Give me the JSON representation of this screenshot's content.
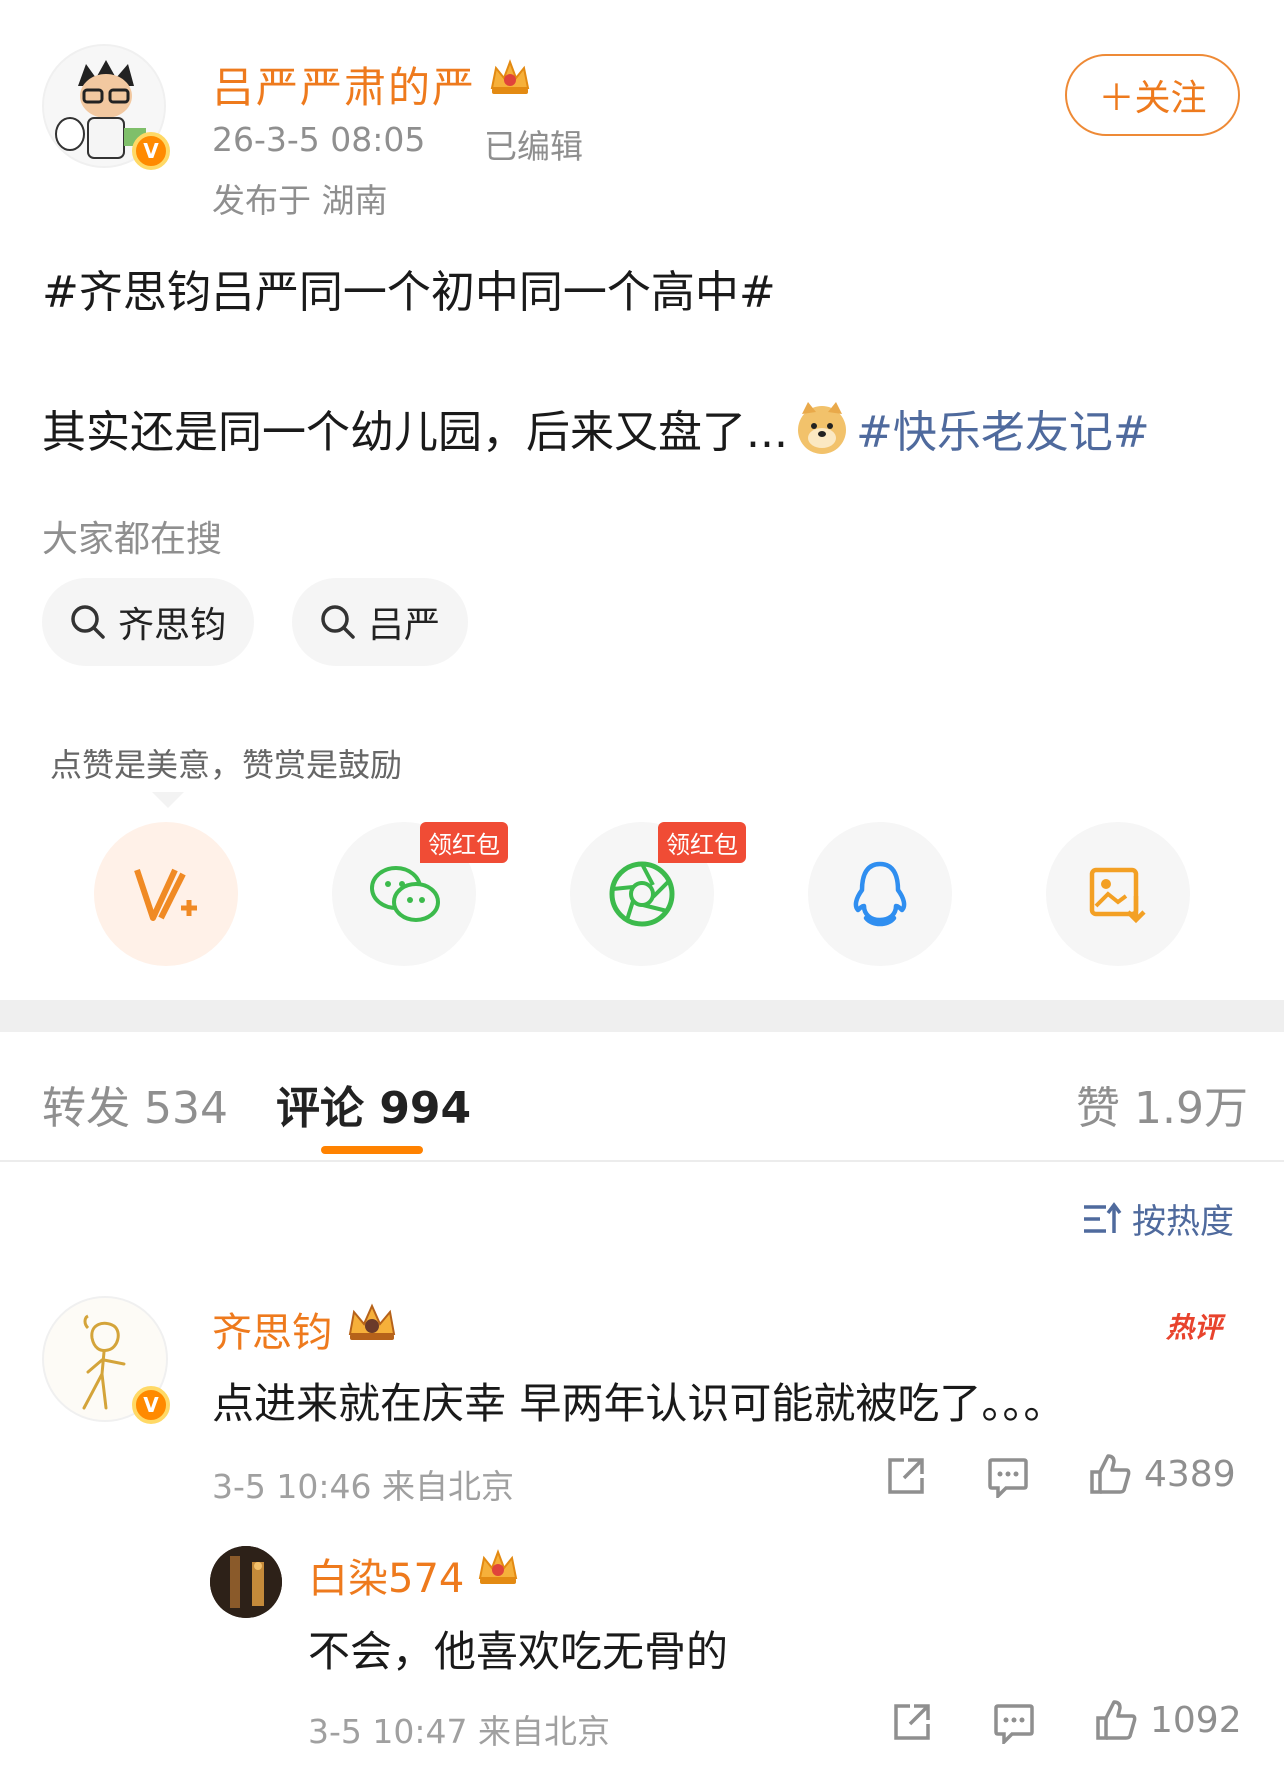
{
  "post": {
    "author": "吕严严肃的严",
    "time": "26-3-5 08:05",
    "edited": "已编辑",
    "location": "发布于 湖南",
    "follow": "＋关注",
    "topic": "#齐思钧吕严同一个初中同一个高中#",
    "text": "其实还是同一个幼儿园，后来又盘了...",
    "topic2": "#快乐老友记#"
  },
  "search": {
    "label": "大家都在搜",
    "chips": [
      "齐思钧",
      "吕严"
    ]
  },
  "share": {
    "tip": "点赞是美意，赞赏是鼓励",
    "redpack": "领红包",
    "icons": [
      "v-plus-icon",
      "wechat-icon",
      "moments-icon",
      "qq-icon",
      "save-image-icon"
    ]
  },
  "tabs": {
    "repost": "转发 534",
    "comment": "评论 994",
    "likes": "赞 1.9万"
  },
  "sort": "按热度",
  "comments": [
    {
      "name": "齐思钧",
      "hot": "热评",
      "text": "点进来就在庆幸 早两年认识可能就被吃了。。。",
      "meta": "3-5 10:46 来自北京",
      "likes": "4389"
    },
    {
      "name": "白染574",
      "text": "不会，他喜欢吃无骨的",
      "meta": "3-5 10:47 来自北京",
      "likes": "1092"
    }
  ],
  "colors": {
    "accent": "#ee7a1d",
    "topic": "#4f6a9d",
    "underline": "#ff8200"
  }
}
